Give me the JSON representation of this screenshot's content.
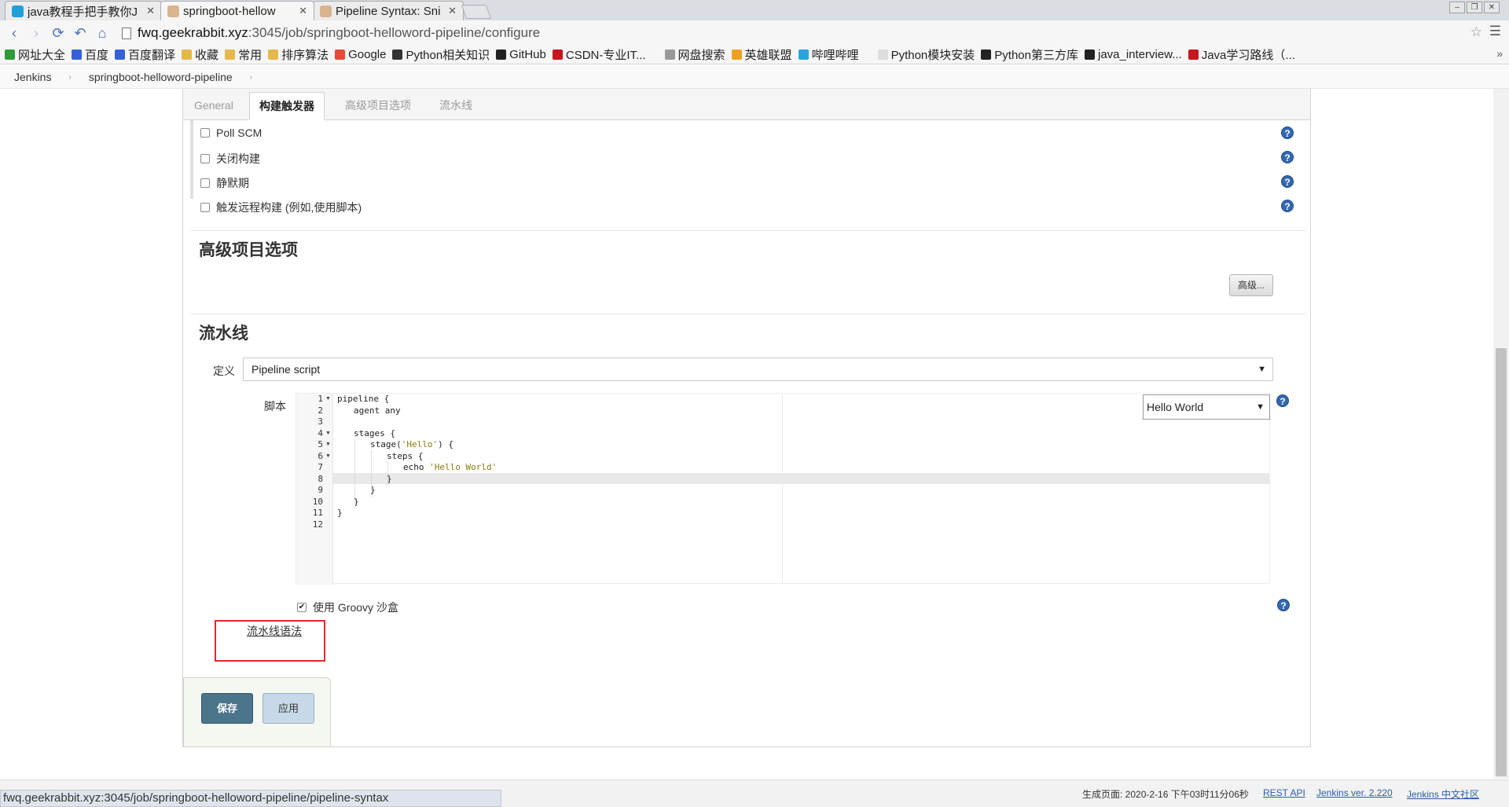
{
  "browser": {
    "tabs": [
      {
        "title": "java教程手把手教你J",
        "active": false
      },
      {
        "title": "springboot-hellow",
        "active": true
      },
      {
        "title": "Pipeline Syntax: Sni",
        "active": false
      }
    ],
    "address_host": "fwq.geekrabbit.xyz",
    "address_path": ":3045/job/springboot-helloword-pipeline/configure",
    "bookmarks": [
      "网址大全",
      "百度",
      "百度翻译",
      "收藏",
      "常用",
      "排序算法",
      "Google",
      "Python相关知识",
      "GitHub",
      "CSDN-专业IT...",
      "网盘搜索",
      "英雄联盟",
      "哔哩哔哩",
      "Python模块安装",
      "Python第三方库",
      "java_interview...",
      "Java学习路线（..."
    ],
    "bookmarks_more": "»"
  },
  "breadcrumb": {
    "items": [
      "Jenkins",
      "springboot-helloword-pipeline"
    ]
  },
  "config_tabs": [
    "General",
    "构建触发器",
    "高级项目选项",
    "流水线"
  ],
  "triggers": [
    "Poll SCM",
    "关闭构建",
    "静默期",
    "触发远程构建 (例如,使用脚本)"
  ],
  "advanced_section": {
    "title": "高级项目选项",
    "button": "高级..."
  },
  "pipeline_section": {
    "title": "流水线",
    "definition_label": "定义",
    "definition_value": "Pipeline script",
    "script_label": "脚本",
    "sample_select": "Hello World",
    "sandbox_label": "使用 Groovy 沙盒",
    "syntax_link": "流水线语法"
  },
  "script_lines": [
    {
      "num": "1",
      "fold": true,
      "indent": 0,
      "text": "pipeline {",
      "str": ""
    },
    {
      "num": "2",
      "fold": false,
      "indent": 1,
      "text": "agent any",
      "str": ""
    },
    {
      "num": "3",
      "fold": false,
      "indent": 0,
      "text": "",
      "str": ""
    },
    {
      "num": "4",
      "fold": true,
      "indent": 1,
      "text": "stages {",
      "str": ""
    },
    {
      "num": "5",
      "fold": true,
      "indent": 2,
      "text": "stage(",
      "str": "'Hello'",
      "after": ") {"
    },
    {
      "num": "6",
      "fold": true,
      "indent": 3,
      "text": "steps {",
      "str": ""
    },
    {
      "num": "7",
      "fold": false,
      "indent": 4,
      "text": "echo ",
      "str": "'Hello World'"
    },
    {
      "num": "8",
      "fold": false,
      "indent": 3,
      "text": "}",
      "str": ""
    },
    {
      "num": "9",
      "fold": false,
      "indent": 2,
      "text": "}",
      "str": ""
    },
    {
      "num": "10",
      "fold": false,
      "indent": 1,
      "text": "}",
      "str": ""
    },
    {
      "num": "11",
      "fold": false,
      "indent": 0,
      "text": "}",
      "str": ""
    },
    {
      "num": "12",
      "fold": false,
      "indent": 0,
      "text": "",
      "str": ""
    }
  ],
  "buttons": {
    "save": "保存",
    "apply": "应用"
  },
  "footer": {
    "generated": "生成页面: 2020-2-16 下午03时11分06秒",
    "rest_api": "REST API",
    "version": "Jenkins ver. 2.220",
    "community": "Jenkins 中文社区"
  },
  "status_url": "fwq.geekrabbit.xyz:3045/job/springboot-helloword-pipeline/pipeline-syntax",
  "colors": {
    "save_button": "#4b758b",
    "apply_button": "#c7d9e8",
    "highlight_box": "#e0282d",
    "help_icon": "#3468b0"
  }
}
